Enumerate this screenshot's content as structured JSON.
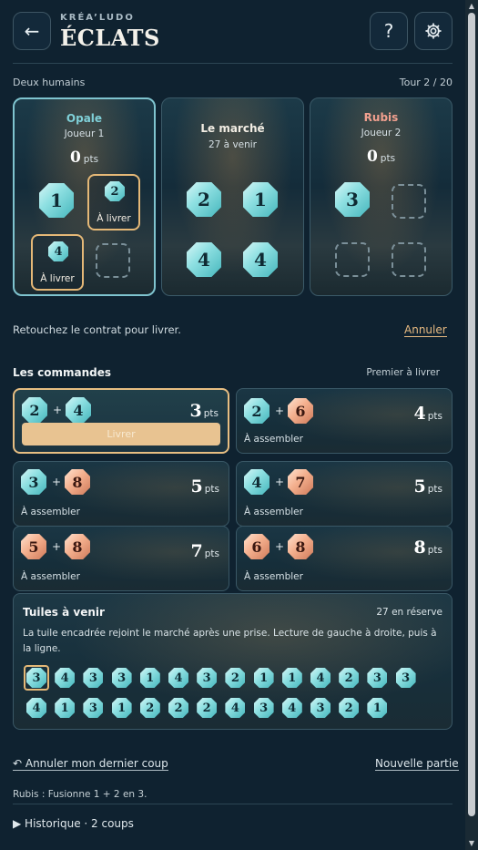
{
  "header": {
    "back_icon": "arrow-left-icon",
    "brand_sub": "KRÉA’LUDO",
    "title": "ÉCLATS",
    "help_label": "?",
    "settings_icon": "gear-icon"
  },
  "meta": {
    "mode": "Deux humains",
    "turn": "Tour 2 / 20"
  },
  "boards": [
    {
      "name": "Opale",
      "name_color": "#7fd0d8",
      "sub": "Joueur 1",
      "points": "0",
      "pts_unit": "pts"
    },
    {
      "name": "Le marché",
      "name_color": "#f3eee4",
      "sub": "27 à venir"
    },
    {
      "name": "Rubis",
      "name_color": "#f2a08f",
      "sub": "Joueur 2",
      "points": "0",
      "pts_unit": "pts"
    }
  ],
  "opale_tiles": {
    "a": "1",
    "b": "2",
    "c": "4",
    "deliver_label": "À livrer"
  },
  "market_tiles": [
    "2",
    "1",
    "4",
    "4"
  ],
  "rubis_tiles": [
    "3"
  ],
  "instruction": "Retouchez le contrat pour livrer.",
  "cancel_label": "Annuler",
  "orders_section": {
    "title": "Les commandes",
    "right": "Premier à livrer"
  },
  "orders": [
    {
      "a": "2",
      "b": "4",
      "a_color": "teal",
      "b_color": "teal",
      "points": "3",
      "unit": "pts",
      "action": "Livrer"
    },
    {
      "a": "2",
      "b": "6",
      "a_color": "teal",
      "b_color": "peach",
      "points": "4",
      "unit": "pts",
      "status": "À assembler"
    },
    {
      "a": "3",
      "b": "8",
      "a_color": "teal",
      "b_color": "peach",
      "points": "5",
      "unit": "pts",
      "status": "À assembler"
    },
    {
      "a": "4",
      "b": "7",
      "a_color": "teal",
      "b_color": "peach",
      "points": "5",
      "unit": "pts",
      "status": "À assembler"
    },
    {
      "a": "5",
      "b": "8",
      "a_color": "peach",
      "b_color": "peach",
      "points": "7",
      "unit": "pts",
      "status": "À assembler"
    },
    {
      "a": "6",
      "b": "8",
      "a_color": "peach",
      "b_color": "peach",
      "points": "8",
      "unit": "pts",
      "status": "À assembler"
    }
  ],
  "plus_sign": "+",
  "upcoming": {
    "title": "Tuiles à venir",
    "reserve": "27 en réserve",
    "description": "La tuile encadrée rejoint le marché après une prise. Lecture de gauche à droite, puis à la ligne.",
    "tiles": [
      "3",
      "4",
      "3",
      "3",
      "1",
      "4",
      "3",
      "2",
      "1",
      "1",
      "4",
      "2",
      "3",
      "3",
      "4",
      "1",
      "3",
      "1",
      "2",
      "2",
      "2",
      "4",
      "3",
      "4",
      "3",
      "2",
      "1"
    ]
  },
  "footer": {
    "undo_label": "↶ Annuler mon dernier coup",
    "new_game_label": "Nouvelle partie",
    "last_move": "Rubis : Fusionne 1 + 2 en 3.",
    "history_label": "▶ Historique · 2 coups"
  },
  "colors": {
    "accent_gold": "#e6b980",
    "accent_teal": "#7fc4cf",
    "background": "#0f2230"
  }
}
